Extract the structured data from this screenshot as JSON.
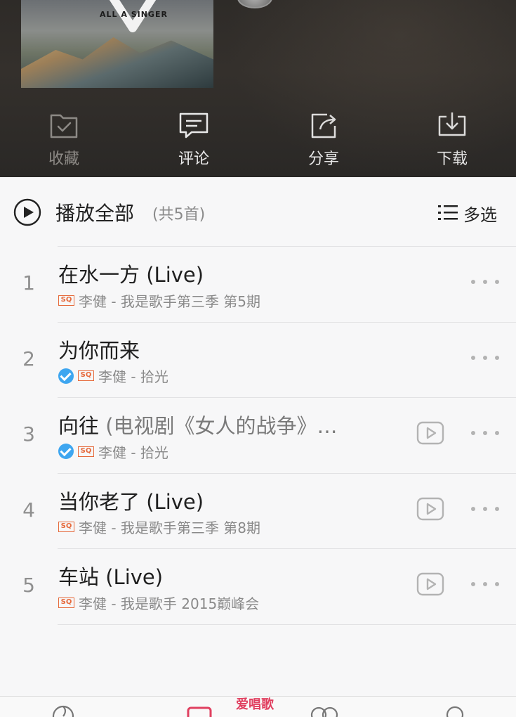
{
  "header": {
    "cover_logo_text": "ALL A SINGER",
    "actions": [
      {
        "label": "收藏",
        "icon": "favorite-folder-icon",
        "enabled": false
      },
      {
        "label": "评论",
        "icon": "comment-icon",
        "enabled": true
      },
      {
        "label": "分享",
        "icon": "share-icon",
        "enabled": true
      },
      {
        "label": "下载",
        "icon": "download-icon",
        "enabled": true
      }
    ]
  },
  "playbar": {
    "title": "播放全部",
    "count": "(共5首)",
    "multi_select": "多选"
  },
  "songs": [
    {
      "num": "1",
      "title": "在水一方 (Live)",
      "title_extra": "",
      "artist_album": "李健 - 我是歌手第三季 第5期",
      "verified": false,
      "sq": "SQ",
      "has_mv": false
    },
    {
      "num": "2",
      "title": "为你而来",
      "title_extra": "",
      "artist_album": "李健 - 拾光",
      "verified": true,
      "sq": "SQ",
      "has_mv": false
    },
    {
      "num": "3",
      "title": "向往",
      "title_extra": " (电视剧《女人的战争》…",
      "artist_album": "李健 - 拾光",
      "verified": true,
      "sq": "SQ",
      "has_mv": true
    },
    {
      "num": "4",
      "title": "当你老了 (Live)",
      "title_extra": "",
      "artist_album": "李健 - 我是歌手第三季 第8期",
      "verified": false,
      "sq": "SQ",
      "has_mv": true
    },
    {
      "num": "5",
      "title": "车站 (Live)",
      "title_extra": "",
      "artist_album": "李健 - 我是歌手 2015巅峰会",
      "verified": false,
      "sq": "SQ",
      "has_mv": true
    }
  ],
  "watermark": "爱唱歌",
  "colors": {
    "accent": "#e66a3c",
    "verified": "#3ea6f0",
    "brand_red": "#e04060"
  }
}
